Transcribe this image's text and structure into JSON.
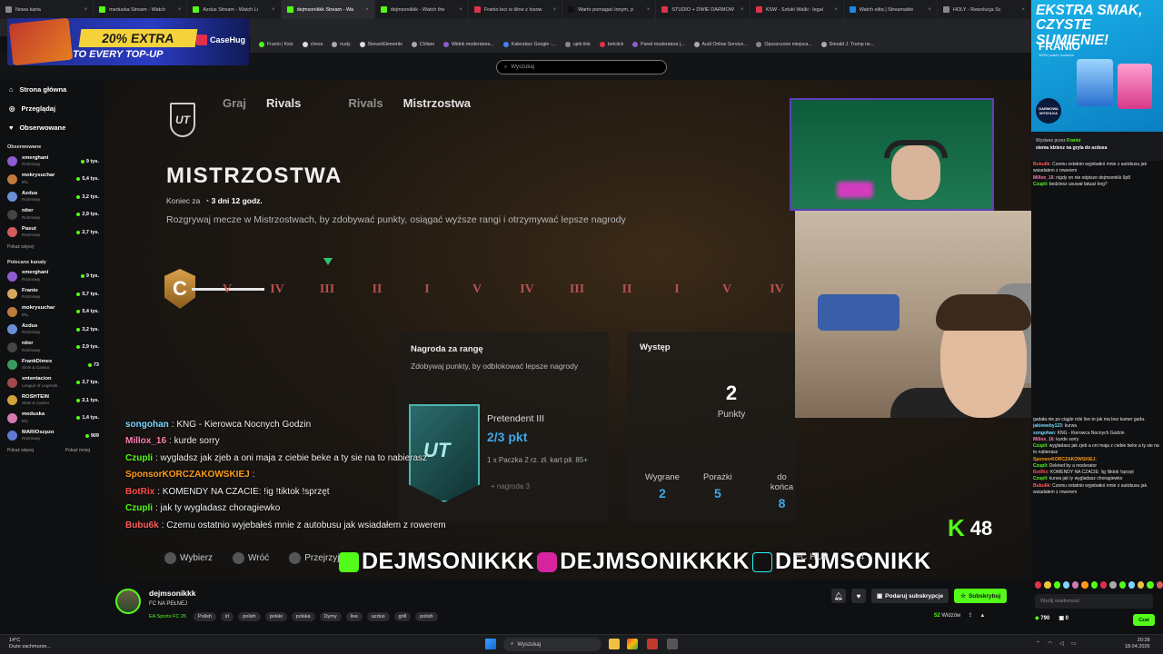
{
  "browser": {
    "tabs": [
      {
        "label": "Nowa karta",
        "color": "#8a8a8a"
      },
      {
        "label": "meduska Stream - Watch",
        "color": "#53fc18"
      },
      {
        "label": "Azdus Stream - Watch Li",
        "color": "#53fc18"
      },
      {
        "label": "dejmsonikkk Stream - Wa",
        "color": "#53fc18",
        "active": true
      },
      {
        "label": "dejmsonikkk - Watch the",
        "color": "#53fc18"
      },
      {
        "label": "Franio leci w śline z losow",
        "color": "#e0314b"
      },
      {
        "label": "Warto pomagać innym, p",
        "color": "#111111"
      },
      {
        "label": "STUDIO + DWIE DARMOW",
        "color": "#e0314b"
      },
      {
        "label": "KSW - Sztuki Walki : legal",
        "color": "#e0314b"
      },
      {
        "label": "Watch elita | Streamable",
        "color": "#1e88e5"
      },
      {
        "label": "HOLY - Rewolucja Sc",
        "color": "#888888"
      }
    ],
    "bookmarks": [
      "Franio | Kick",
      "chess",
      "nudy",
      "StreamElements",
      "Chilam",
      "Widok moderatora...",
      "Kalendarz Google -...",
      "ujeb link",
      "betclick",
      "Panel moderatora |...",
      "Audi Online Service...",
      "Opuszczone miejsca...",
      "Donald J. Trump ne..."
    ],
    "search_placeholder": "Wyszukaj"
  },
  "casehug": {
    "badge": "20% EXTRA",
    "sub": "TO EVERY TOP-UP",
    "logo": "CaseHug"
  },
  "sidebar": {
    "nav": [
      {
        "label": "Strona główna",
        "icon": "home-icon"
      },
      {
        "label": "Przeglądaj",
        "icon": "compass-icon"
      },
      {
        "label": "Obserwowane",
        "icon": "heart-icon"
      }
    ],
    "followed_title": "Obserwowane",
    "followed": [
      {
        "name": "xmerghani",
        "cat": "Rozmowy",
        "viewers": "9 tys.",
        "color": "#8e5bd0"
      },
      {
        "name": "mokrysuchar",
        "cat": "IRL",
        "viewers": "5,4 tys.",
        "color": "#c07a3a"
      },
      {
        "name": "Azdus",
        "cat": "Rozmowy",
        "viewers": "3,2 tys.",
        "color": "#6b8fd6"
      },
      {
        "name": "niter",
        "cat": "Rozmowy",
        "viewers": "2,9 tys.",
        "color": "#444"
      },
      {
        "name": "Pasut",
        "cat": "Rozmowy",
        "viewers": "2,7 tys.",
        "color": "#d65c5c"
      }
    ],
    "followed_more": "Pokaż więcej",
    "rec_title": "Polecane kanały",
    "recommended": [
      {
        "name": "xmerghani",
        "cat": "Rozmowy",
        "viewers": "9 tys.",
        "color": "#8e5bd0"
      },
      {
        "name": "Franio",
        "cat": "Rozmowy",
        "viewers": "5,7 tys.",
        "color": "#d6a85c"
      },
      {
        "name": "mokrysuchar",
        "cat": "IRL",
        "viewers": "5,4 tys.",
        "color": "#c07a3a"
      },
      {
        "name": "Azdus",
        "cat": "Rozmowy",
        "viewers": "3,2 tys.",
        "color": "#6b8fd6"
      },
      {
        "name": "niter",
        "cat": "Rozmowy",
        "viewers": "2,9 tys.",
        "color": "#444"
      },
      {
        "name": "FrankDimes",
        "cat": "Slots & Casino",
        "viewers": "73",
        "color": "#3a9a5c"
      },
      {
        "name": "xntentacion",
        "cat": "League of Legends",
        "viewers": "2,7 tys.",
        "color": "#a04a4a"
      },
      {
        "name": "ROSHTEIN",
        "cat": "Slots & Casino",
        "viewers": "2,1 tys.",
        "color": "#d0a23a"
      },
      {
        "name": "meduska",
        "cat": "IRL",
        "viewers": "1,4 tys.",
        "color": "#d67ab0"
      },
      {
        "name": "MARIOszpzo",
        "cat": "Rozmowy",
        "viewers": "909",
        "color": "#5c7ad6"
      }
    ],
    "rec_more": "Pokaż więcej",
    "rec_less": "Pokaż mniej"
  },
  "game": {
    "logo": "UT",
    "tabs": [
      "Graj",
      "Rivals",
      "Rivals",
      "Mistrzostwa"
    ],
    "title": "MISTRZOSTWA",
    "end_label": "Koniec za",
    "end_value": "3 dni 12 godz.",
    "desc": "Rozgrywaj mecze w Mistrzostwach, by zdobywać punkty, osiągać wyższe rangi i otrzymywać lepsze nagrody",
    "current_rank": "C",
    "ranks": [
      "V",
      "IV",
      "III",
      "II",
      "I",
      "V",
      "IV",
      "III",
      "II",
      "I",
      "V",
      "IV"
    ],
    "reward": {
      "title": "Nagroda za rangę",
      "desc": "Zdobywaj punkty, by odblokować lepsze nagrody",
      "card": "UT",
      "name": "Pretendent III",
      "points": "2/3 pkt",
      "detail": "1 x Paczka 2 rz. zł. kart pił. 85+",
      "extra": "+ nagroda 3"
    },
    "stats": {
      "title": "Występ",
      "points": "2",
      "points_label": "Punkty",
      "cols": [
        {
          "label": "Wygrane",
          "value": "2"
        },
        {
          "label": "Porażki",
          "value": "5"
        },
        {
          "label": "do końca",
          "value": "8"
        }
      ]
    },
    "bottom": [
      "Wybierz",
      "Wróć",
      "Przejrzyj"
    ],
    "hub": "FC HUB",
    "hub_num1": "1",
    "hub_num2": "4",
    "kick_count": "48",
    "socials": [
      "DEJMSONIKKK",
      "DEJMSONIKKKK",
      "DEJMSONIKK"
    ]
  },
  "overlay_chat": [
    {
      "user": "songohan",
      "color": "#7bd7ff",
      "text": ": KNG - Kierowca Nocnych Godzin"
    },
    {
      "user": "Millox_16",
      "color": "#ff7eb3",
      "text": ": kurde sorry"
    },
    {
      "user": "Czupli",
      "color": "#53fc18",
      "text": ": wygladsz jak zjeb a oni maja z ciebie beke a ty sie na to nabierasz"
    },
    {
      "user": "SponsorKORCZAKOWSKIEJ",
      "color": "#ff9c1a",
      "text": ":"
    },
    {
      "user": "BotRix",
      "color": "#ff4d4d",
      "text": ": KOMENDY NA CZACIE: !ig !tiktok !sprzęt"
    },
    {
      "user": "Czupli",
      "color": "#53fc18",
      "text": ": jak ty wygladasz choragiewko"
    },
    {
      "user": "Bubu6k",
      "color": "#ff5c5c",
      "text": ": Czemu ostatnio wyjebałeś mnie z autobusu jak wsiadałem z rowerem"
    }
  ],
  "stream": {
    "name": "dejmsonikkk",
    "title": "FC NA PEŁNEJ",
    "category": "EA Sports FC 26",
    "tags": [
      "Polish",
      "irl",
      "polish",
      "polski",
      "polska",
      "Dymy",
      "live",
      "azdus",
      "grill",
      "polish"
    ],
    "gift_label": "Podaruj subskrypcje",
    "sub_label": "Subskrybuj",
    "viewers": "52",
    "viewers_label": "Widzów"
  },
  "ad": {
    "t1": "EKSTRA SMAK, CZYSTE SUMIENIE!",
    "brand": "FRANIO",
    "fine": "100% polski i kolorem",
    "badge": "DARMOWA WYSYŁKA"
  },
  "chat": {
    "pinned_by": "Wysłane przez",
    "pinned_user": "Franio",
    "pinned_text": "siema idziesz na gryla do azdusa",
    "top": [
      {
        "user": "Bubu6k",
        "color": "#ff5c5c",
        "text": ": Czemu ostatnio wyjebałeś mnie z autobusu jak wsiadałem z rowerem"
      },
      {
        "user": "Millox_16",
        "color": "#ff7eb3",
        "text": ": nigdy on nie odpisze dejmsonikk 9p8"
      },
      {
        "user": "Czupli",
        "color": "#53fc18",
        "text": ": bedziesz usuwał tatuaż kng?"
      }
    ],
    "bottom": [
      {
        "user": "",
        "color": "#ffffff",
        "text": "gadała nie po ciągle robi live to jak ma bez kamer gada."
      },
      {
        "user": "jakieweby123",
        "color": "#7bd7ff",
        "text": ": kurwa"
      },
      {
        "user": "songohan",
        "color": "#7bd7ff",
        "text": ": KNG - Kierowca Nocnych Godzin"
      },
      {
        "user": "Millox_16",
        "color": "#ff7eb3",
        "text": ": kurde sorry"
      },
      {
        "user": "Czupli",
        "color": "#53fc18",
        "text": ": wygladasz jak zjeb a oni maja z ciebie beke a ty sie na to nabierasz"
      },
      {
        "user": "SponsorKORCZAKOWSKIEJ",
        "color": "#ff9c1a",
        "text": ":"
      },
      {
        "user": "Czupli",
        "color": "#53fc18",
        "text": ": Deleted by a moderator"
      },
      {
        "user": "BotRix",
        "color": "#ff4d4d",
        "text": ": KOMENDY NA CZACIE: !ig !tiktok !sprzęt"
      },
      {
        "user": "Czupli",
        "color": "#53fc18",
        "text": ": kurwa jak ty wygladasz choragiewko"
      },
      {
        "user": "Bubu6k",
        "color": "#ff5c5c",
        "text": ": Czemu ostatnio wyjebałeś mnie z autobusu jak wsiadałem z rowerem"
      }
    ],
    "placeholder": "Wyślij wiadomość",
    "points": "790",
    "other": "0",
    "send_label": "Czat"
  },
  "taskbar": {
    "temp": "14°C",
    "weather": "Duże zachmurze...",
    "search": "Wyszukaj",
    "time": "20:28",
    "date": "18.04.2026"
  }
}
